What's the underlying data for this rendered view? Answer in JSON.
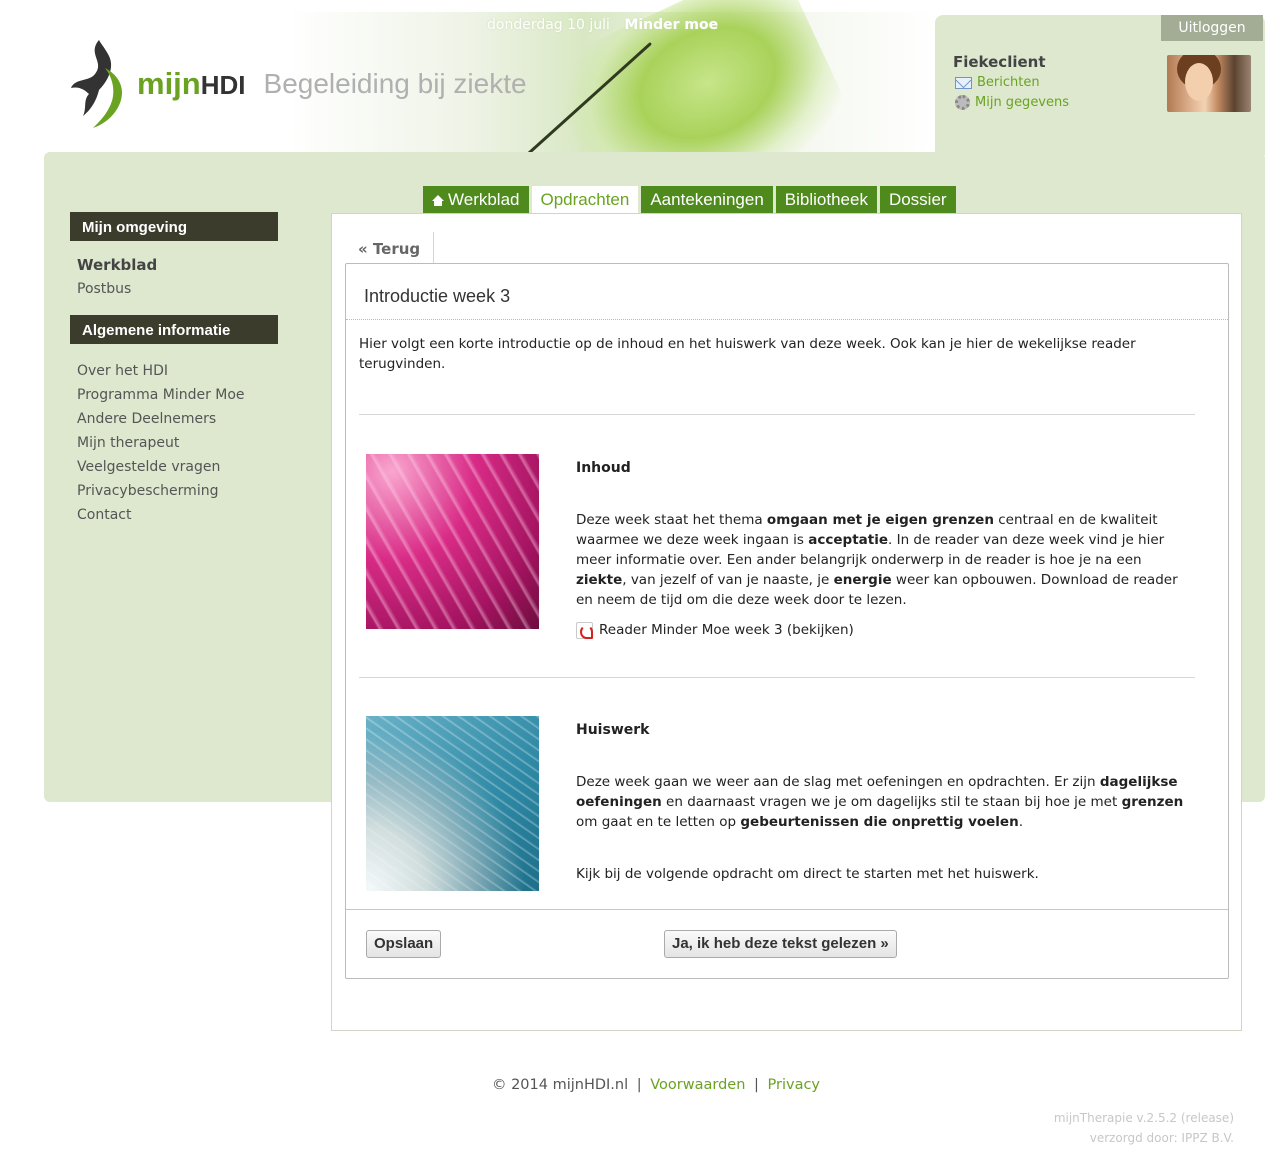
{
  "header": {
    "date": "donderdag 10 juli",
    "program": "Minder moe",
    "logo_word": "mijn",
    "logo_brand": "HDI",
    "logo_tagline": "Begeleiding bij ziekte"
  },
  "user": {
    "logout_label": "Uitloggen",
    "name": "Fiekeclient",
    "messages_label": "Berichten",
    "account_label": "Mijn gegevens"
  },
  "sidebar": {
    "group1_title": "Mijn omgeving",
    "group1_items": [
      "Werkblad",
      "Postbus"
    ],
    "group2_title": "Algemene informatie",
    "group2_items": [
      "Over het HDI",
      "Programma Minder Moe",
      "Andere Deelnemers",
      "Mijn therapeut",
      "Veelgestelde vragen",
      "Privacybescherming",
      "Contact"
    ]
  },
  "tabs": [
    "Werkblad",
    "Opdrachten",
    "Aantekeningen",
    "Bibliotheek",
    "Dossier"
  ],
  "active_tab": "Opdrachten",
  "main": {
    "back_label": "« Terug",
    "title": "Introductie week 3",
    "intro": "Hier volgt een korte introductie op de inhoud en het huiswerk van deze week. Ook kan je hier de wekelijkse reader terugvinden.",
    "sections": [
      {
        "heading": "Inhoud",
        "body": [
          "Deze week staat het thema ",
          "omgaan met je eigen grenzen",
          " centraal en de kwaliteit waarmee we deze week ingaan is ",
          "acceptatie",
          ". In de reader van deze week vind je hier meer informatie over. Een ander belangrijk onderwerp in de reader is hoe je na een ",
          "ziekte",
          ", van jezelf of van je naaste, je ",
          "energie",
          " weer kan opbouwen. Download de reader en neem de tijd om die deze week door te lezen."
        ],
        "link": "Reader Minder Moe week 3 (bekijken)"
      },
      {
        "heading": "Huiswerk",
        "body": [
          "Deze week gaan we weer aan de slag met oefeningen en opdrachten. Er zijn ",
          "dagelijkse oefeningen",
          " en daarnaast vragen we je om dagelijks stil te staan bij hoe je met ",
          "grenzen",
          " om gaat en te letten op ",
          "gebeurtenissen die onprettig voelen",
          "."
        ],
        "extra": "Kijk bij de volgende opdracht om direct te starten met het huiswerk."
      }
    ],
    "save_label": "Opslaan",
    "confirm_label": "Ja, ik heb deze tekst gelezen »"
  },
  "footer": {
    "copyright": "© 2014 mijnHDI.nl",
    "terms": "Voorwaarden",
    "privacy": "Privacy",
    "version": "mijnTherapie v.2.5.2 (release)",
    "provider": "verzorgd door: IPPZ B.V."
  },
  "colors": {
    "accent_green": "#6aa322",
    "tab_green": "#4f8a1d",
    "panel_green": "#dde8cf",
    "sidebar_head": "#3c3c2c"
  }
}
